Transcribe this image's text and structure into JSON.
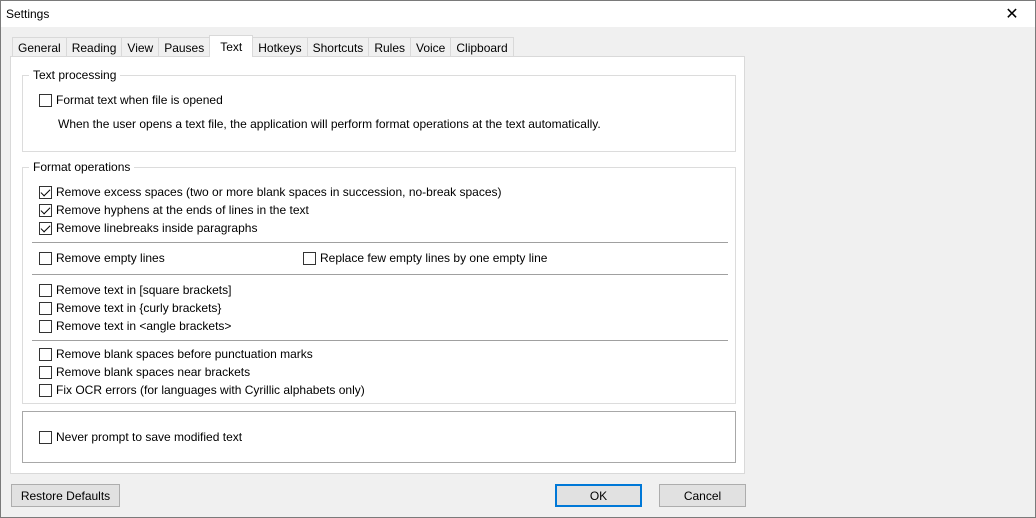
{
  "window": {
    "title": "Settings"
  },
  "tabs": [
    {
      "label": "General"
    },
    {
      "label": "Reading"
    },
    {
      "label": "View"
    },
    {
      "label": "Pauses"
    },
    {
      "label": "Text"
    },
    {
      "label": "Hotkeys"
    },
    {
      "label": "Shortcuts"
    },
    {
      "label": "Rules"
    },
    {
      "label": "Voice"
    },
    {
      "label": "Clipboard"
    }
  ],
  "active_tab": "Text",
  "text_processing": {
    "legend": "Text processing",
    "format_on_open": {
      "label": "Format text when file is opened",
      "checked": false
    },
    "description": "When the user opens a text file, the application will perform format operations at the text automatically."
  },
  "format_operations": {
    "legend": "Format operations",
    "remove_excess_spaces": {
      "label": "Remove excess spaces (two or more blank spaces in succession, no-break spaces)",
      "checked": true
    },
    "remove_hyphens": {
      "label": "Remove hyphens at the ends of lines in the text",
      "checked": true
    },
    "remove_linebreaks": {
      "label": "Remove linebreaks inside paragraphs",
      "checked": true
    },
    "remove_empty_lines": {
      "label": "Remove empty lines",
      "checked": false
    },
    "replace_empty_lines": {
      "label": "Replace few empty lines by one empty line",
      "checked": false
    },
    "remove_square": {
      "label": "Remove text in [square brackets]",
      "checked": false
    },
    "remove_curly": {
      "label": "Remove text in {curly brackets}",
      "checked": false
    },
    "remove_angle": {
      "label": "Remove text in <angle brackets>",
      "checked": false
    },
    "remove_spaces_punct": {
      "label": "Remove blank spaces before punctuation marks",
      "checked": false
    },
    "remove_spaces_brackets": {
      "label": "Remove blank spaces near brackets",
      "checked": false
    },
    "fix_ocr": {
      "label": "Fix OCR errors (for languages with Cyrillic alphabets only)",
      "checked": false
    }
  },
  "misc": {
    "never_prompt": {
      "label": "Never prompt to save modified text",
      "checked": false
    }
  },
  "buttons": {
    "restore_defaults": "Restore Defaults",
    "ok": "OK",
    "cancel": "Cancel"
  },
  "icons": {
    "close": "close-icon"
  }
}
